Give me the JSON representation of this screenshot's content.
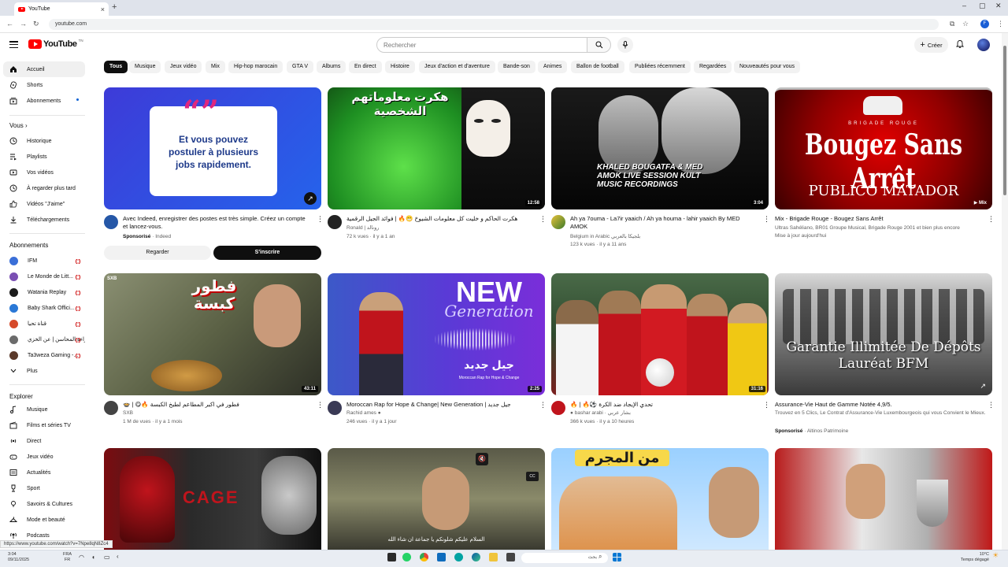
{
  "browser": {
    "tab_title": "YouTube",
    "url": "youtube.com",
    "status_url": "https://www.youtube.com/watch?v=7Npe8qN8Zc4"
  },
  "header": {
    "logo_text": "YouTube",
    "logo_country": "TN",
    "search_placeholder": "Rechercher",
    "create_label": "Créer"
  },
  "sidebar": {
    "main": [
      {
        "label": "Accueil",
        "icon": "home-icon"
      },
      {
        "label": "Shorts",
        "icon": "shorts-icon"
      },
      {
        "label": "Abonnements",
        "icon": "subscriptions-icon"
      }
    ],
    "you_heading": "Vous",
    "you": [
      {
        "label": "Historique",
        "icon": "history-icon"
      },
      {
        "label": "Playlists",
        "icon": "playlist-icon"
      },
      {
        "label": "Vos vidéos",
        "icon": "your-videos-icon"
      },
      {
        "label": "À regarder plus tard",
        "icon": "watch-later-icon"
      },
      {
        "label": "Vidéos \"J'aime\"",
        "icon": "like-icon"
      },
      {
        "label": "Téléchargements",
        "icon": "download-icon"
      }
    ],
    "subs_heading": "Abonnements",
    "subs": [
      {
        "label": "IFM",
        "color": "#3a6fd8",
        "live": true
      },
      {
        "label": "Le Monde de Litt...",
        "color": "#7a4fb3",
        "live": true
      },
      {
        "label": "Watania Replay",
        "color": "#1b1b1b",
        "live": true
      },
      {
        "label": "Baby Shark Offici...",
        "color": "#2a78d6",
        "live": true
      },
      {
        "label": "قناة تحيا",
        "color": "#d64a2a",
        "live": true
      },
      {
        "label": "قراءة المحاسن | عن الخزي",
        "color": "#6b6b6b",
        "live": true
      },
      {
        "label": "Ta3weza Gaming -...",
        "color": "#5b3a2a",
        "live": true
      },
      {
        "label": "Plus",
        "color": "",
        "live": false
      }
    ],
    "explore_heading": "Explorer",
    "explore": [
      {
        "label": "Musique",
        "icon": "music-icon"
      },
      {
        "label": "Films et séries TV",
        "icon": "movies-icon"
      },
      {
        "label": "Direct",
        "icon": "live-icon"
      },
      {
        "label": "Jeux vidéo",
        "icon": "gaming-icon"
      },
      {
        "label": "Actualités",
        "icon": "news-icon"
      },
      {
        "label": "Sport",
        "icon": "sports-icon"
      },
      {
        "label": "Savoirs & Cultures",
        "icon": "learning-icon"
      },
      {
        "label": "Mode et beauté",
        "icon": "fashion-icon"
      },
      {
        "label": "Podcasts",
        "icon": "podcast-icon"
      }
    ]
  },
  "chips": [
    "Tous",
    "Musique",
    "Jeux vidéo",
    "Mix",
    "Hip-hop marocain",
    "GTA V",
    "Albums",
    "En direct",
    "Histoire",
    "Jeux d'action et d'aventure",
    "Bande-son",
    "Animes",
    "Ballon de football",
    "Publiées récemment",
    "Regardées",
    "Nouveautés pour vous"
  ],
  "ad": {
    "thumb_text": "Et vous pouvez postuler à plusieurs jobs rapidement.",
    "title": "Avec Indeed, enregistrer des postes est très simple. Créez un compte et lancez-vous.",
    "sponsor": "Sponsorisé",
    "advertiser": "Indeed",
    "watch_label": "Regarder",
    "signup_label": "S'inscrire"
  },
  "videos": [
    {
      "title": "هكرت الحاكم و خليت كل معلومات الشيوخ 😬🔥 | فوائد الجيل الرقمية",
      "channel": "Ronald | رونالد",
      "meta": "72 k vues · il y a 1 an",
      "duration": "12:58",
      "thumb_text": "هكرت معلوماتهم الشخصية"
    },
    {
      "title": "Ah ya 7ouma - La7ir yaaich / Ah ya houma - lahir yaaich By MED AMOK",
      "channel": "Belgium in Arabic بلجيكا بالعربي",
      "meta": "123 k vues · il y a 11 ans",
      "duration": "3:04",
      "thumb_text": "KHALED BOUGATFA & MED AMOK LIVE SESSION KULT MUSIC RECORDINGS"
    },
    {
      "title": "Mix - Brigade Rouge - Bougez Sans Arrêt",
      "channel": "Ultras Sahéliano, BR01 Groupe Musical, Brigade Rouge 2001 et bien plus encore",
      "meta": "Mise à jour aujourd'hui",
      "duration": "Mix",
      "thumb_text": "Bougez Sans Arrêt",
      "thumb_sub": "PUBLICO MATADOR",
      "thumb_top": "BRIGADE ROUGE"
    },
    {
      "title": "فطور في اكبر المطاعم لطبخ الكبسة 🔥😋 | 🍲",
      "channel": "SXB",
      "meta": "1 M de vues · il y a 1 mois",
      "duration": "43:11",
      "thumb_text": "فطور كبسة"
    },
    {
      "title": "Moroccan Rap for Hope & Change| New Generation | جيل جديد",
      "channel": "Rachid ames",
      "meta": "246 vues · il y a 1 jour",
      "duration": "2:25",
      "thumb_text": "NEW",
      "thumb_sub": "Generation",
      "thumb_arabic": "جيل جديد",
      "thumb_small": "Moroccan Rap for Hope & Change"
    },
    {
      "title": "تحدي الإيجاد ضد الكرة ⚽🔥 | 🔥",
      "channel": "bashar arabi · بشار عربي",
      "meta": "366 k vues · il y a 10 heures",
      "duration": "31:16"
    },
    {
      "title": "Assurance-Vie Haut de Gamme Notée 4,9/5.",
      "channel": "Trouvez en 5 Clics, Le Contrat d'Assurance-Vie Luxembourgeois qui vous Convient le Mieux.",
      "meta": "Altinos Patrimoine",
      "sponsor": "Sponsorisé",
      "thumb_text": "Garantie Illimitée De Dépôts Lauréat BFM"
    },
    {
      "title": "",
      "channel": "",
      "meta": "",
      "thumb_text": "CAGE"
    },
    {
      "title": "",
      "channel": "",
      "meta": "",
      "thumb_text": "السلام عليكم شلونكم يا جماعة ان شاء الله"
    },
    {
      "title": "",
      "channel": "",
      "meta": "",
      "thumb_text": "من المجرم"
    },
    {
      "title": "",
      "channel": "",
      "meta": "",
      "thumb_text": ""
    }
  ],
  "taskbar": {
    "search_placeholder": "بحث",
    "time": "3:04",
    "date": "09/11/2025",
    "lang": "FRA",
    "lang_sub": "FR",
    "weather": "10°C",
    "weather_desc": "Temps dégagé"
  },
  "colors": {
    "yt_red": "#ff0000",
    "chip_bg": "#f2f2f2",
    "text": "#0f0f0f",
    "meta": "#606060"
  }
}
